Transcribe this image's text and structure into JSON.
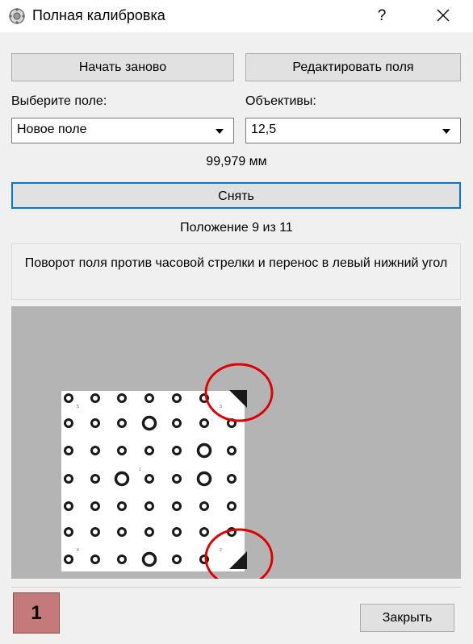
{
  "window": {
    "title": "Полная калибровка",
    "help_label": "?"
  },
  "toolbar": {
    "restart_label": "Начать заново",
    "edit_fields_label": "Редактировать поля"
  },
  "field_select": {
    "label": "Выберите поле:",
    "value": "Новое поле"
  },
  "lens_select": {
    "label": "Объективы:",
    "value": "12,5"
  },
  "measurement": "99,979 мм",
  "capture_label": "Снять",
  "position_text": "Положение 9 из 11",
  "instruction": "Поворот поля против часовой стрелки и перенос в левый нижний угол",
  "preview": {
    "small_marks": [
      "5",
      "3",
      "1",
      "4",
      "2"
    ],
    "highlight_color": "#e00000"
  },
  "badge": "1",
  "close_label": "Закрыть"
}
